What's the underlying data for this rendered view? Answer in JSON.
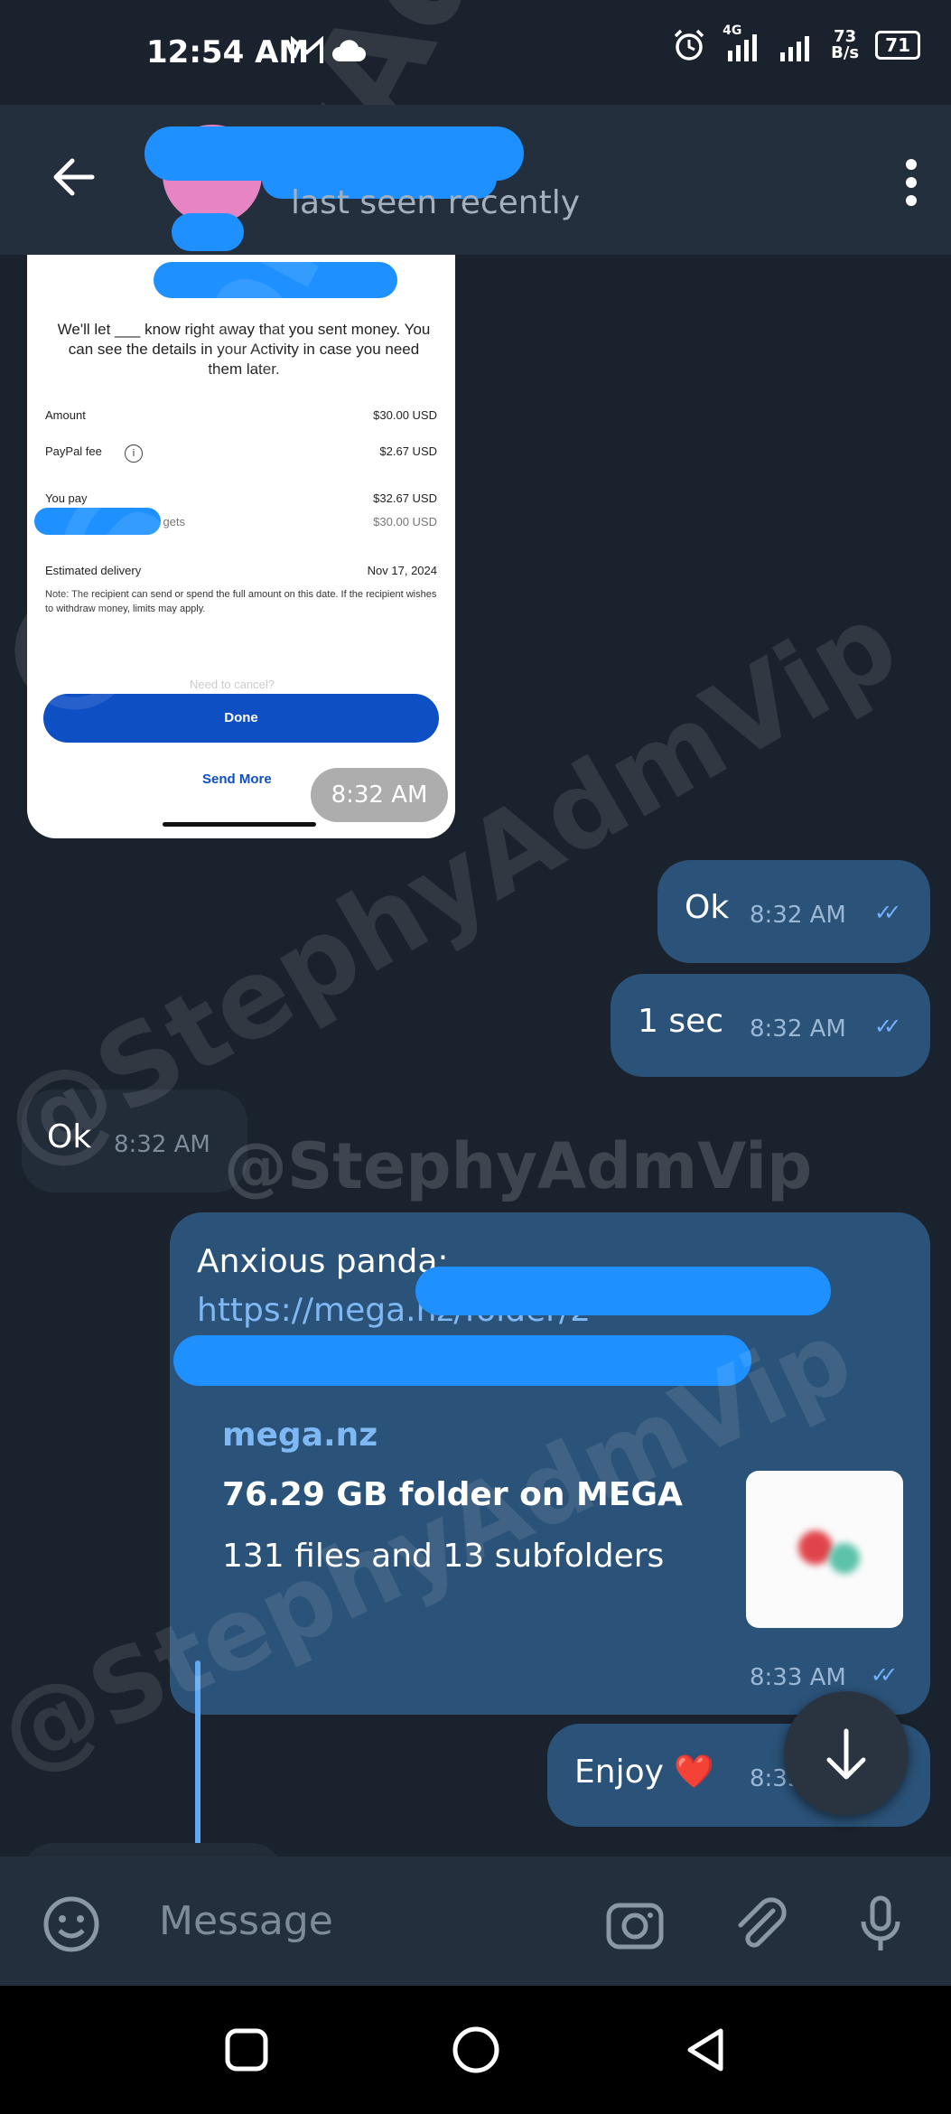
{
  "status_bar": {
    "time": "12:54 AM",
    "network_type": "4G",
    "data_speed_value": "73",
    "data_speed_unit": "B/s",
    "battery": "71",
    "icons": [
      "gmail-icon",
      "cloud-icon",
      "alarm-icon",
      "signal-icon",
      "signal-icon-2"
    ]
  },
  "header": {
    "contact_name": "",
    "status": "last seen recently"
  },
  "photo_message": {
    "intro_text": "We'll let ___ know right away that you sent money. You can see the details in your Activity in case you need them later.",
    "rows": [
      {
        "label": "Amount",
        "value": "$30.00 USD"
      },
      {
        "label": "PayPal fee",
        "value": "$2.67 USD"
      },
      {
        "label": "You pay",
        "value": "$32.67 USD"
      },
      {
        "label": "...mail.com gets",
        "value": "$30.00 USD"
      },
      {
        "label": "Estimated delivery",
        "value": "Nov 17, 2024"
      }
    ],
    "note": "Note: The recipient can send or spend the full amount on this date. If the recipient wishes to withdraw money, limits may apply.",
    "need_to_cancel": "Need to cancel?",
    "done_label": "Done",
    "send_more_label": "Send More",
    "time": "8:32 AM"
  },
  "messages": [
    {
      "direction": "out",
      "text": "Ok",
      "time": "8:32 AM",
      "status": "read"
    },
    {
      "direction": "out",
      "text": "1 sec",
      "time": "8:32 AM",
      "status": "read"
    },
    {
      "direction": "in",
      "text": "Ok",
      "time": "8:32 AM"
    },
    {
      "direction": "out",
      "text": "Anxious panda:",
      "link": "https://mega.nz/folder/2",
      "time": "8:33 AM",
      "status": "read"
    },
    {
      "direction": "out",
      "text": "Enjoy ❤️",
      "time": "8:33 AM",
      "status": "read"
    }
  ],
  "link_preview": {
    "site": "mega.nz",
    "title": "76.29 GB folder on MEGA",
    "description": "131 files and 13 subfolders"
  },
  "watermark": "@StephyAdmVip",
  "input_bar": {
    "placeholder": "Message"
  },
  "colors": {
    "background": "#1a222d",
    "header": "#242f3d",
    "outgoing_bubble": "#2b5278",
    "incoming_bubble": "#222c39",
    "link": "#62a9f3",
    "paypal_blue": "#0f4fc4"
  }
}
